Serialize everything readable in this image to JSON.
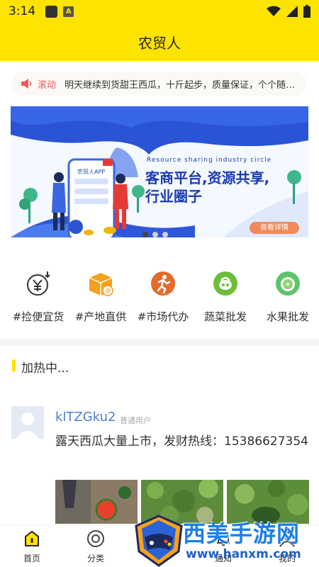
{
  "status_bar": {
    "time": "3:14"
  },
  "header": {
    "title": "农贸人"
  },
  "notice": {
    "label": "滚动",
    "text": "明天继续到货甜王西瓜，十斤起步，质量保证，个个随便…"
  },
  "banner": {
    "subtitle_en": "Resource sharing industry circle",
    "headline_line1": "客商平台,资源共享,",
    "headline_line2": "行业圈子",
    "button_label": "查看详情",
    "app_label": "农贸人APP",
    "slides": 3,
    "active_slide": 1
  },
  "categories": [
    {
      "label": "#捡便宜货",
      "icon": "yen-coin-icon",
      "color": "#333333"
    },
    {
      "label": "#产地直供",
      "icon": "box-icon",
      "color": "#f5a020"
    },
    {
      "label": "#市场代办",
      "icon": "runner-icon",
      "color": "#e36b2d"
    },
    {
      "label": "蔬菜批发",
      "icon": "vegetable-icon",
      "color": "#6bbf3a"
    },
    {
      "label": "水果批发",
      "icon": "fruit-icon",
      "color": "#5cc46a"
    }
  ],
  "section": {
    "title": "加热中..."
  },
  "post": {
    "username": "klTZGku2",
    "role": "普通用户",
    "text": "露天西瓜大量上市，发财热线：15386627354"
  },
  "tabbar": [
    {
      "label": "首页",
      "icon": "home-icon",
      "active": true
    },
    {
      "label": "分类",
      "icon": "category-icon",
      "active": false
    },
    {
      "label": "通知",
      "icon": "bell-icon",
      "active": false
    },
    {
      "label": "我的",
      "icon": "user-icon",
      "active": false
    }
  ],
  "watermark": {
    "title": "西美手游网",
    "url": "www.hanxm.com"
  },
  "colors": {
    "brand_yellow": "#fde300",
    "link_blue": "#4a7fc7",
    "notice_red": "#f2575e"
  }
}
